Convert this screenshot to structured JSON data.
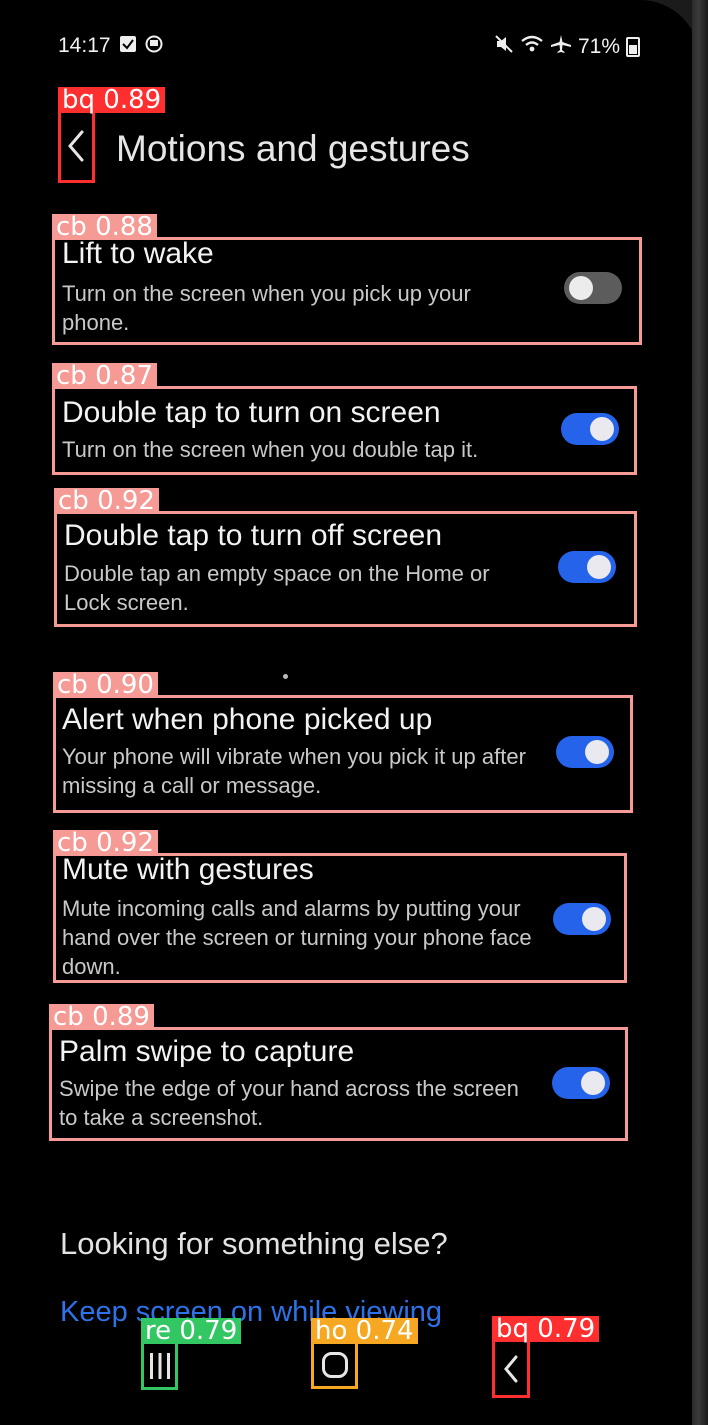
{
  "status_bar": {
    "time": "14:17",
    "battery_percent": "71%",
    "left_icons": [
      "notification-check-icon",
      "sync-icon"
    ],
    "right_icons": [
      "mute-icon",
      "wifi-icon",
      "airplane-icon",
      "battery-icon"
    ]
  },
  "header": {
    "title": "Motions and gestures",
    "back_icon": "chevron-left-icon"
  },
  "settings": [
    {
      "title": "Lift to wake",
      "description": "Turn on the screen when you pick up your phone.",
      "enabled": false
    },
    {
      "title": "Double tap to turn on screen",
      "description": "Turn on the screen when you double tap it.",
      "enabled": true
    },
    {
      "title": "Double tap to turn off screen",
      "description": "Double tap an empty space on the Home or Lock screen.",
      "enabled": true
    },
    {
      "title": "Alert when phone picked up",
      "description": "Your phone will vibrate when you pick it up after missing a call or message.",
      "enabled": true
    },
    {
      "title": "Mute with gestures",
      "description": "Mute incoming calls and alarms by putting your hand over the screen or turning your phone face down.",
      "enabled": true
    },
    {
      "title": "Palm swipe to capture",
      "description": "Swipe the edge of your hand across the screen to take a screenshot.",
      "enabled": true
    }
  ],
  "footer": {
    "looking_heading": "Looking for something else?",
    "link": "Keep screen on while viewing"
  },
  "nav_bar": {
    "recents_icon": "recents-icon",
    "home_icon": "home-icon",
    "back_icon": "back-icon"
  },
  "detections": {
    "back_header": "bq 0.89",
    "setting_0": "cb 0.88",
    "setting_1": "cb 0.87",
    "setting_2": "cb 0.92",
    "setting_3": "cb 0.90",
    "setting_4": "cb 0.92",
    "setting_5": "cb 0.89",
    "nav_recents": "re 0.79",
    "nav_home": "ho 0.74",
    "nav_back": "bq 0.79"
  },
  "colors": {
    "accent": "#2563eb",
    "link": "#2d72e8",
    "det_back": "#ff2f2f",
    "det_checkbox": "#f59a95",
    "det_recents": "#32c763",
    "det_home": "#f7a823"
  }
}
